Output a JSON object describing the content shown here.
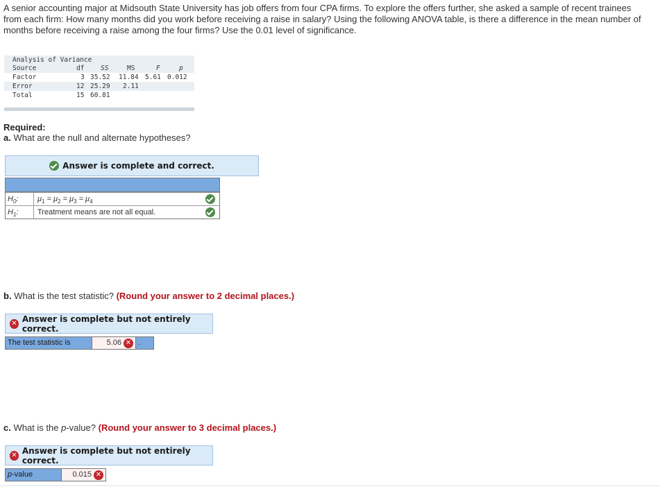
{
  "problem": {
    "intro": "A senior accounting major at Midsouth State University has job offers from four CPA firms. To explore the offers further, she asked a sample of recent trainees from each firm: How many months did you work before receiving a raise in salary? Using the following ANOVA table, is there a difference in the mean number of months before receiving a raise among the four firms? Use the 0.01 level of significance."
  },
  "anova_table": {
    "title": "Analysis of Variance",
    "headers": [
      "Source",
      "df",
      "SS",
      "MS",
      "F",
      "p"
    ],
    "rows": [
      {
        "source": "Factor",
        "df": "3",
        "ss": "35.52",
        "ms": "11.84",
        "f": "5.61",
        "p": "0.012"
      },
      {
        "source": "Error",
        "df": "12",
        "ss": "25.29",
        "ms": "2.11",
        "f": "",
        "p": ""
      },
      {
        "source": "Total",
        "df": "15",
        "ss": "60.81",
        "ms": "",
        "f": "",
        "p": ""
      }
    ]
  },
  "required_label": "Required:",
  "part_a": {
    "letter": "a.",
    "question": "What are the null and alternate hypotheses?",
    "banner": "Answer is complete and correct.",
    "banner_icon": "check-circle-icon",
    "rows": [
      {
        "label": "H",
        "label_sub": "0",
        "value_html_parts": [
          "μ",
          "1",
          " = μ",
          "2",
          " = μ",
          "3",
          " = μ",
          "4"
        ],
        "status": "correct"
      },
      {
        "label": "H",
        "label_sub": "1",
        "value": "Treatment means are not all equal.",
        "status": "correct"
      }
    ]
  },
  "part_b": {
    "letter": "b.",
    "question": "What is the test statistic?",
    "instruction": "(Round your answer to 2 decimal places.)",
    "banner": "Answer is complete but not entirely correct.",
    "banner_icon": "x-circle-icon",
    "field_label": "The test statistic is",
    "field_value": "5.06",
    "field_status": "incorrect",
    "tail": "."
  },
  "part_c": {
    "letter": "c.",
    "question_pre": "What is the ",
    "question_italic": "p",
    "question_post": "-value?",
    "instruction": "(Round your answer to 3 decimal places.)",
    "banner": "Answer is complete but not entirely correct.",
    "banner_icon": "x-circle-icon",
    "field_label_italic": "p",
    "field_label_rest": "-value",
    "field_value": "0.015",
    "field_status": "incorrect"
  },
  "colors": {
    "correct": "#4f8a4b",
    "incorrect": "#c0262c",
    "instruction_red": "#b3141c",
    "banner_bg": "#dbeaf7",
    "cell_blue": "#7aa9df"
  }
}
